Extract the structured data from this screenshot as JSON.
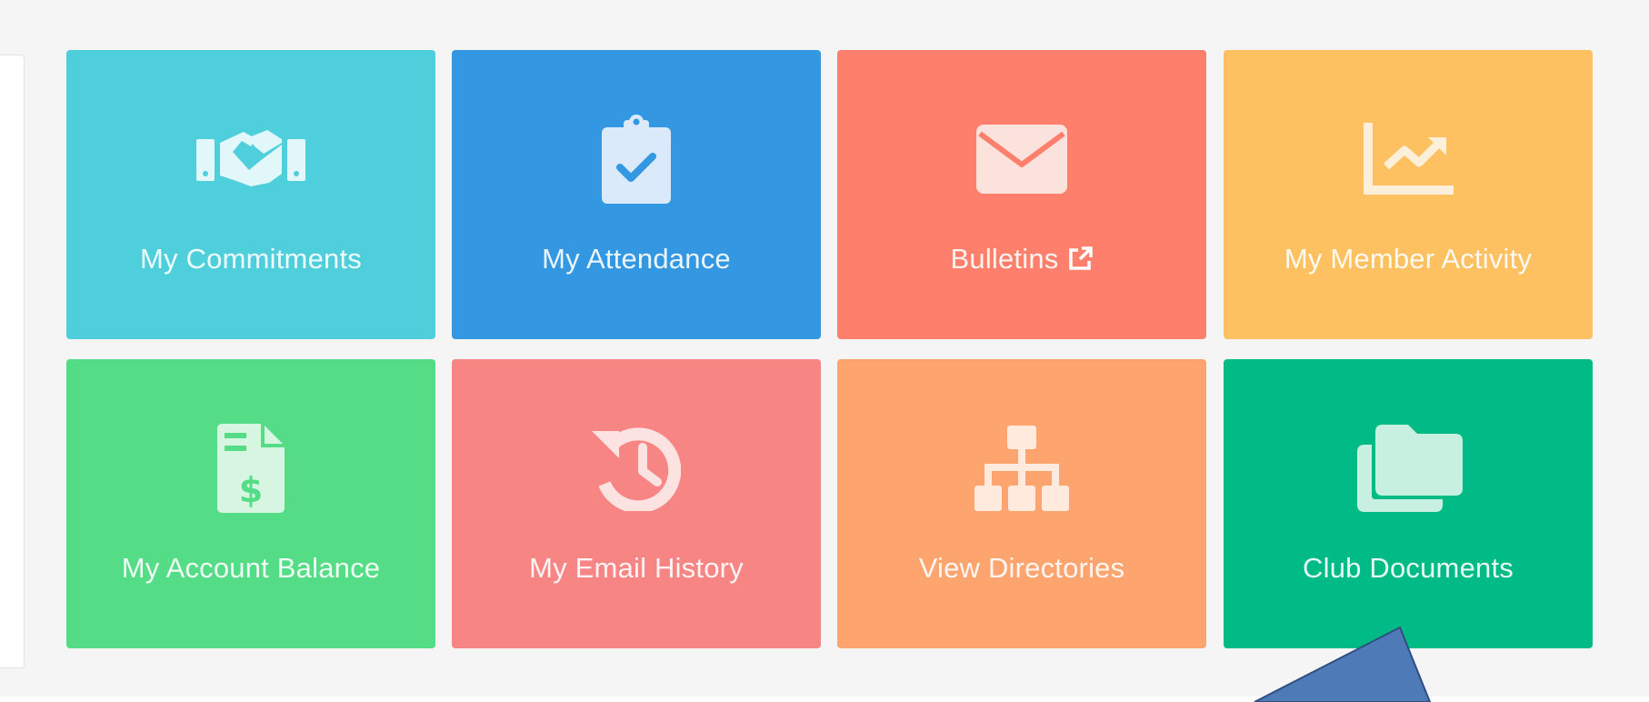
{
  "tiles": [
    {
      "key": "commitments",
      "label": "My Commitments",
      "icon": "handshake-icon",
      "color": "#4fcfdc",
      "external": false
    },
    {
      "key": "attendance",
      "label": "My Attendance",
      "icon": "clipboard-check-icon",
      "color": "#3397e1",
      "external": false
    },
    {
      "key": "bulletins",
      "label": "Bulletins",
      "icon": "envelope-icon",
      "color": "#fe806c",
      "external": true,
      "external_icon": "external-link-icon"
    },
    {
      "key": "member_activity",
      "label": "My Member Activity",
      "icon": "chart-line-icon",
      "color": "#fdc162",
      "external": false
    },
    {
      "key": "account_balance",
      "label": "My Account Balance",
      "icon": "invoice-dollar-icon",
      "color": "#55dc87",
      "external": false
    },
    {
      "key": "email_history",
      "label": "My Email History",
      "icon": "history-icon",
      "color": "#f68584",
      "external": false
    },
    {
      "key": "directories",
      "label": "View Directories",
      "icon": "sitemap-icon",
      "color": "#fea46f",
      "external": false
    },
    {
      "key": "club_documents",
      "label": "Club Documents",
      "icon": "folders-icon",
      "color": "#00bb86",
      "external": false
    }
  ],
  "colors": {
    "page_background": "#f5f5f5",
    "annotation_arrow": "#4f7ab8"
  }
}
